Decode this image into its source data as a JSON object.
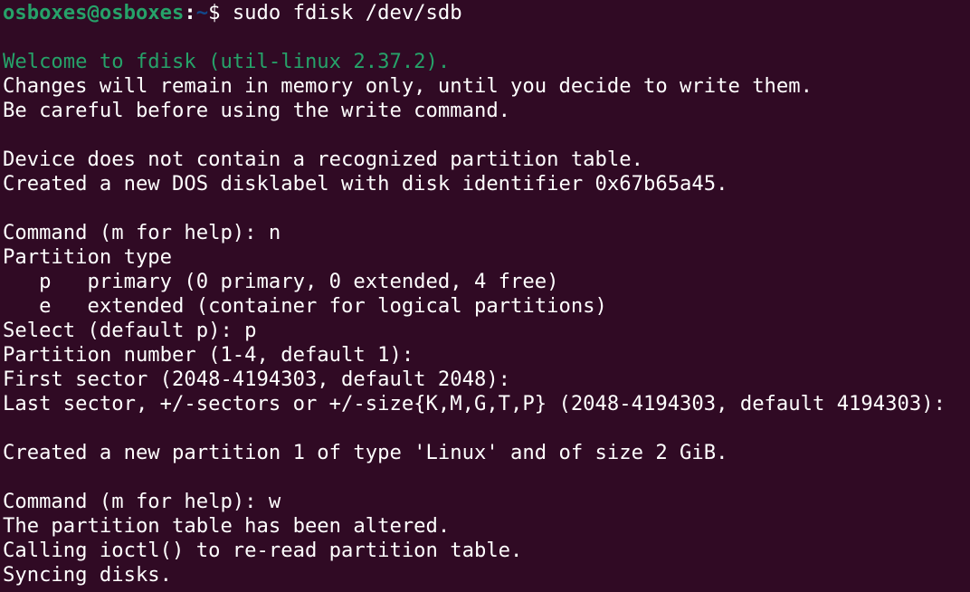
{
  "terminal": {
    "prompt": {
      "user_host": "osboxes@osboxes",
      "separator": ":",
      "path": "~",
      "symbol": "$ ",
      "command": "sudo fdisk /dev/sdb"
    },
    "colors": {
      "background": "#300a24",
      "prompt_user": "#26a269",
      "prompt_path": "#12488b",
      "welcome": "#26a269",
      "text": "#ffffff"
    },
    "lines": [
      "",
      "Welcome to fdisk (util-linux 2.37.2).",
      "Changes will remain in memory only, until you decide to write them.",
      "Be careful before using the write command.",
      "",
      "Device does not contain a recognized partition table.",
      "Created a new DOS disklabel with disk identifier 0x67b65a45.",
      "",
      "Command (m for help): n",
      "Partition type",
      "   p   primary (0 primary, 0 extended, 4 free)",
      "   e   extended (container for logical partitions)",
      "Select (default p): p",
      "Partition number (1-4, default 1):",
      "First sector (2048-4194303, default 2048):",
      "Last sector, +/-sectors or +/-size{K,M,G,T,P} (2048-4194303, default 4194303):",
      "",
      "Created a new partition 1 of type 'Linux' and of size 2 GiB.",
      "",
      "Command (m for help): w",
      "The partition table has been altered.",
      "Calling ioctl() to re-read partition table.",
      "Syncing disks."
    ]
  }
}
